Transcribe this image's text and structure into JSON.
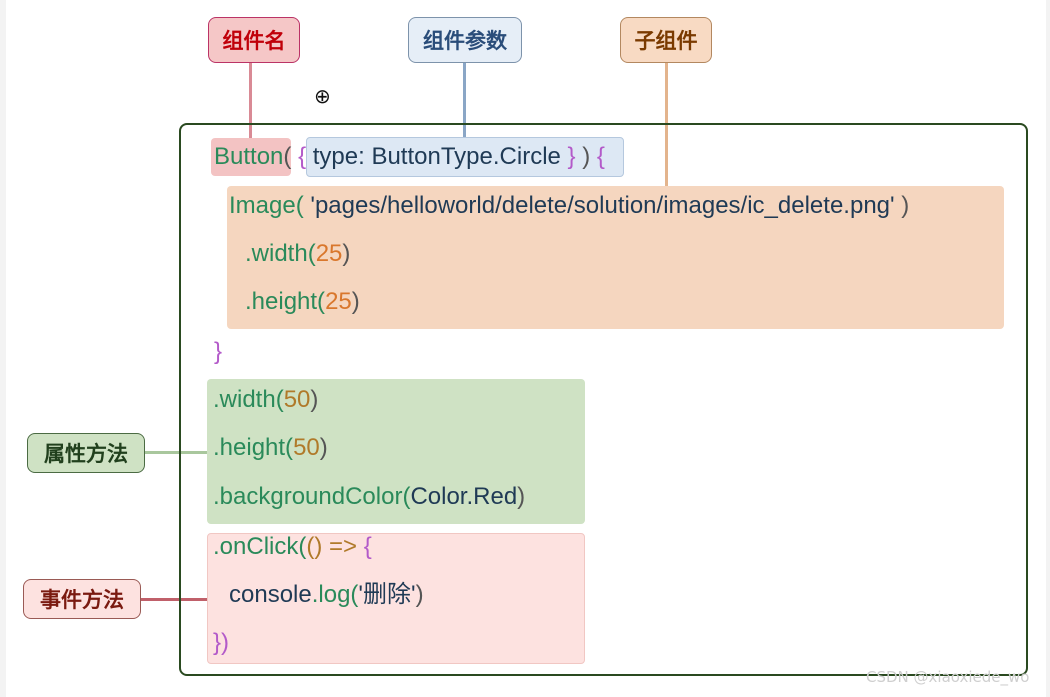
{
  "labels": {
    "component_name": "组件名",
    "component_params": "组件参数",
    "child_component": "子组件",
    "attribute_methods": "属性方法",
    "event_methods": "事件方法"
  },
  "code": {
    "button": "Button",
    "open_paren": "(",
    "open_brace_param": "{",
    "param_key": "type:",
    "param_value": "ButtonType.Circle",
    "close_brace_param": "}",
    "close_paren_brace": ")",
    "open_brace_body": "{",
    "image_call": "Image(",
    "image_path": "'pages/helloworld/delete/solution/images/ic_delete.png'",
    "image_close": ")",
    "image_width": ".width(",
    "image_width_val": "25",
    "image_height": ".height(",
    "image_height_val": "25",
    "close_paren": ")",
    "close_brace": "}",
    "width": ".width(",
    "width_val": "50",
    "height": ".height(",
    "height_val": "50",
    "bg_color": ".backgroundColor(",
    "bg_color_val": "Color.Red",
    "onclick": ".onClick(",
    "arrow": "() =>",
    "onclick_open": "{",
    "console": "console",
    "log": ".log(",
    "log_arg": "'删除'",
    "onclick_close": "})"
  },
  "watermark": "CSDN @xiaoxiede_wo",
  "icons": {
    "cursor": "zoom-in-cursor-icon"
  },
  "colors": {
    "name_bg": "#f5c7c7",
    "param_bg": "#e6eef7",
    "child_bg": "#f8dac3",
    "attr_bg": "#cfe2c4",
    "event_bg": "#fde2e0"
  }
}
